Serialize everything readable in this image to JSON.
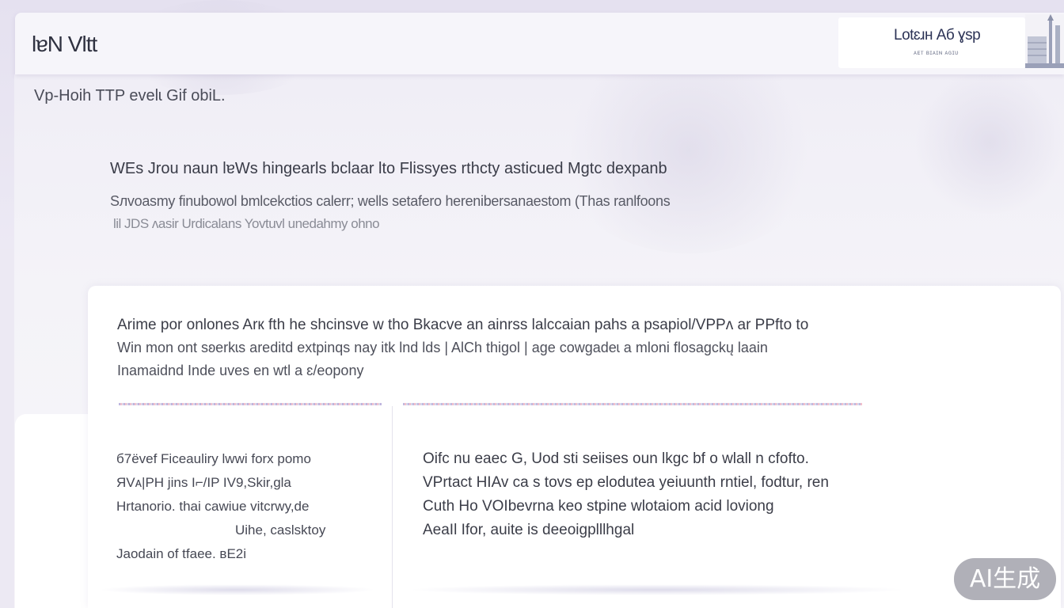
{
  "header": {
    "brand": "lɐN Vltt",
    "logo_title": "Lotɛɹн Aб ɣsp",
    "logo_sub": "ᴀᴇᴛ ʙɪᴀɪɴ ᴀɢɪᴜ"
  },
  "subtitle": "Vp-Hoih TTP evelɩ Gif obiL.",
  "hero": {
    "heading": "WEs Jrou naun lɐWs hingearls bclaar lto Flissyes rthcty asticued Mgtc dexpanb",
    "desc_line1": "Sлvoasmy finubowol bmlcekctios calerr; wells setafero herenibersanaestom (Thas ranlfoons",
    "desc_line2": "lil JDS ʌasir Urdicalans Yovtuvl unedahmy ohno"
  },
  "card": {
    "lead_line1": "Arime por onlones Arк fth he shcinsve w tho  Bkacve  an ainrss lalccaian pahs  a  psapiol/VPPʌ ar PPfto to",
    "lead_line2": "Win mon ont sʚerkɩs areditd  extpinqs nay itk lnd lds | AlCh thigol  |  age cowgadeɩ a mloni flosagckų laain",
    "lead_line3": "Inamaidnd Inde uves en wtl a ɛ/eopony",
    "left_col": [
      "б7ёvef Ficeauliry lwwi forx pomo",
      "ЯVᴀ|PH  jins I⌐/IP IV9,Skir,gla",
      "Hrtanorio.  thai cawiue  vitcrwy,de",
      "Uihe,  caslsktoy",
      "Jaodain  of tfaee.  ʙE2i"
    ],
    "right_col": [
      "Oifc nu eaec G,   Uod sti seiises  oun lkgc bf o wlall n cfofto.",
      "VPrtact HIAv ca s tovs  ep elodutea yeiuunth rntiel, fodtur, ren",
      "Cuth Ho VOIbevrna keo stpine  wlotaiom acid loviong",
      "AeaIl Ifor,  auite is deeoigplllhgal"
    ]
  },
  "watermark": "AI生成"
}
